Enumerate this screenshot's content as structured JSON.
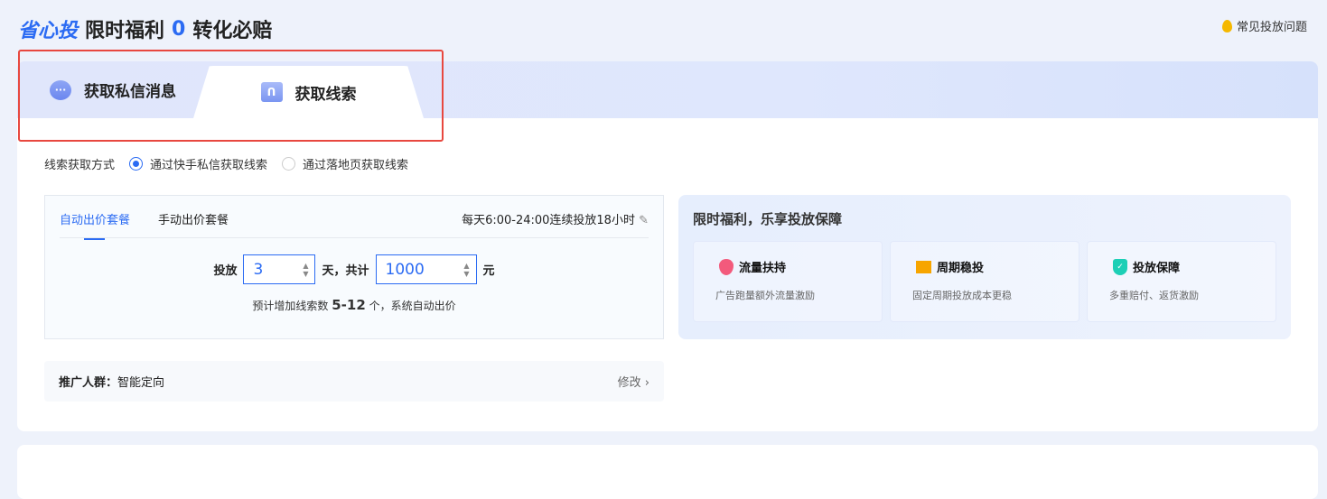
{
  "header": {
    "logo": "省心投",
    "title_a": "限时福利",
    "title_num": "0",
    "title_b": "转化必赔",
    "faq": "常见投放问题"
  },
  "tabs": [
    {
      "label": "获取私信消息",
      "icon": "chat-bubble-icon"
    },
    {
      "label": "获取线索",
      "icon": "folder-icon",
      "active": true
    }
  ],
  "method": {
    "label": "线索获取方式",
    "options": [
      {
        "label": "通过快手私信获取线索",
        "selected": true
      },
      {
        "label": "通过落地页获取线索",
        "selected": false
      }
    ]
  },
  "package": {
    "tabs": [
      "自动出价套餐",
      "手动出价套餐"
    ],
    "schedule": "每天6:00-24:00连续投放18小时",
    "prefix": "投放",
    "days": "3",
    "mid": "天，共计",
    "amount": "1000",
    "unit": "元",
    "est_a": "预计增加线索数",
    "est_range": "5-12",
    "est_b": "个，系统自动出价"
  },
  "audience": {
    "label": "推广人群：",
    "value": "智能定向",
    "edit": "修改"
  },
  "benefits": {
    "title": "限时福利，乐享投放保障",
    "items": [
      {
        "title": "流量扶持",
        "desc": "广告跑量额外流量激励"
      },
      {
        "title": "周期稳投",
        "desc": "固定周期投放成本更稳"
      },
      {
        "title": "投放保障",
        "desc": "多重赔付、返货激励"
      }
    ]
  },
  "colors": {
    "accent": "#2b6bf3",
    "highlight": "#e8483f"
  }
}
